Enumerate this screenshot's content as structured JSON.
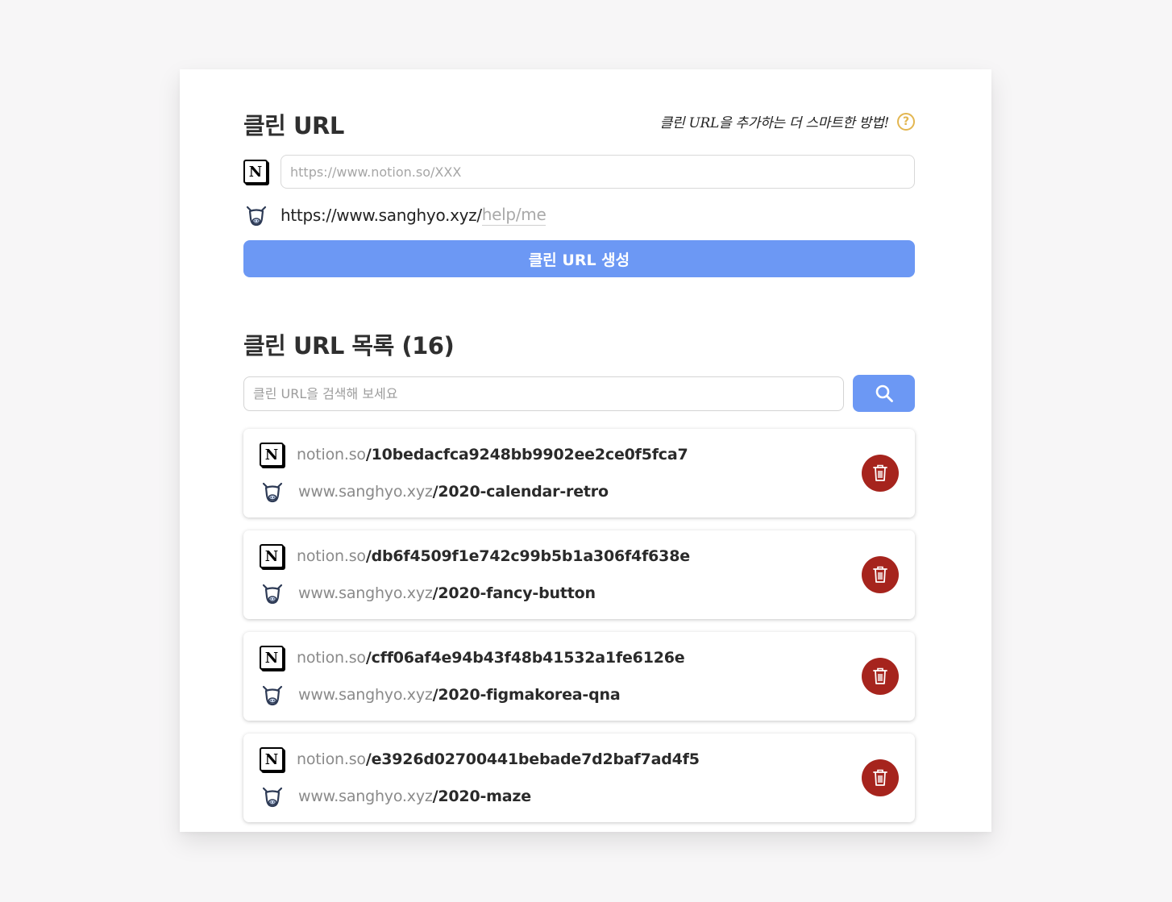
{
  "header": {
    "title": "클린 URL",
    "hint": "클린 URL을 추가하는 더 스마트한 방법!",
    "help_icon": "question-circle-icon"
  },
  "form": {
    "notion_placeholder": "https://www.notion.so/XXX",
    "notion_value": "",
    "clean_base": "https://www.sanghyo.xyz/",
    "clean_slug_placeholder": "help/me",
    "create_label": "클린 URL 생성"
  },
  "list": {
    "title": "클린 URL 목록 (16)",
    "search_placeholder": "클린 URL을 검색해 보세요",
    "items": [
      {
        "notion_domain": "notion.so",
        "notion_path": "/10bedacfca9248bb9902ee2ce0f5fca7",
        "clean_domain": "www.sanghyo.xyz",
        "clean_path": "/2020-calendar-retro"
      },
      {
        "notion_domain": "notion.so",
        "notion_path": "/db6f4509f1e742c99b5b1a306f4f638e",
        "clean_domain": "www.sanghyo.xyz",
        "clean_path": "/2020-fancy-button"
      },
      {
        "notion_domain": "notion.so",
        "notion_path": "/cff06af4e94b43f48b41532a1fe6126e",
        "clean_domain": "www.sanghyo.xyz",
        "clean_path": "/2020-figmakorea-qna"
      },
      {
        "notion_domain": "notion.so",
        "notion_path": "/e3926d02700441bebade7d2baf7ad4f5",
        "clean_domain": "www.sanghyo.xyz",
        "clean_path": "/2020-maze"
      }
    ]
  },
  "colors": {
    "primary": "#6c98f4",
    "danger": "#a6241d",
    "help": "#e3b650",
    "background": "#f7f6f7"
  },
  "icons": {
    "notion": "notion-logo-icon",
    "cow": "cow-icon",
    "search": "search-icon",
    "trash": "trash-icon"
  }
}
